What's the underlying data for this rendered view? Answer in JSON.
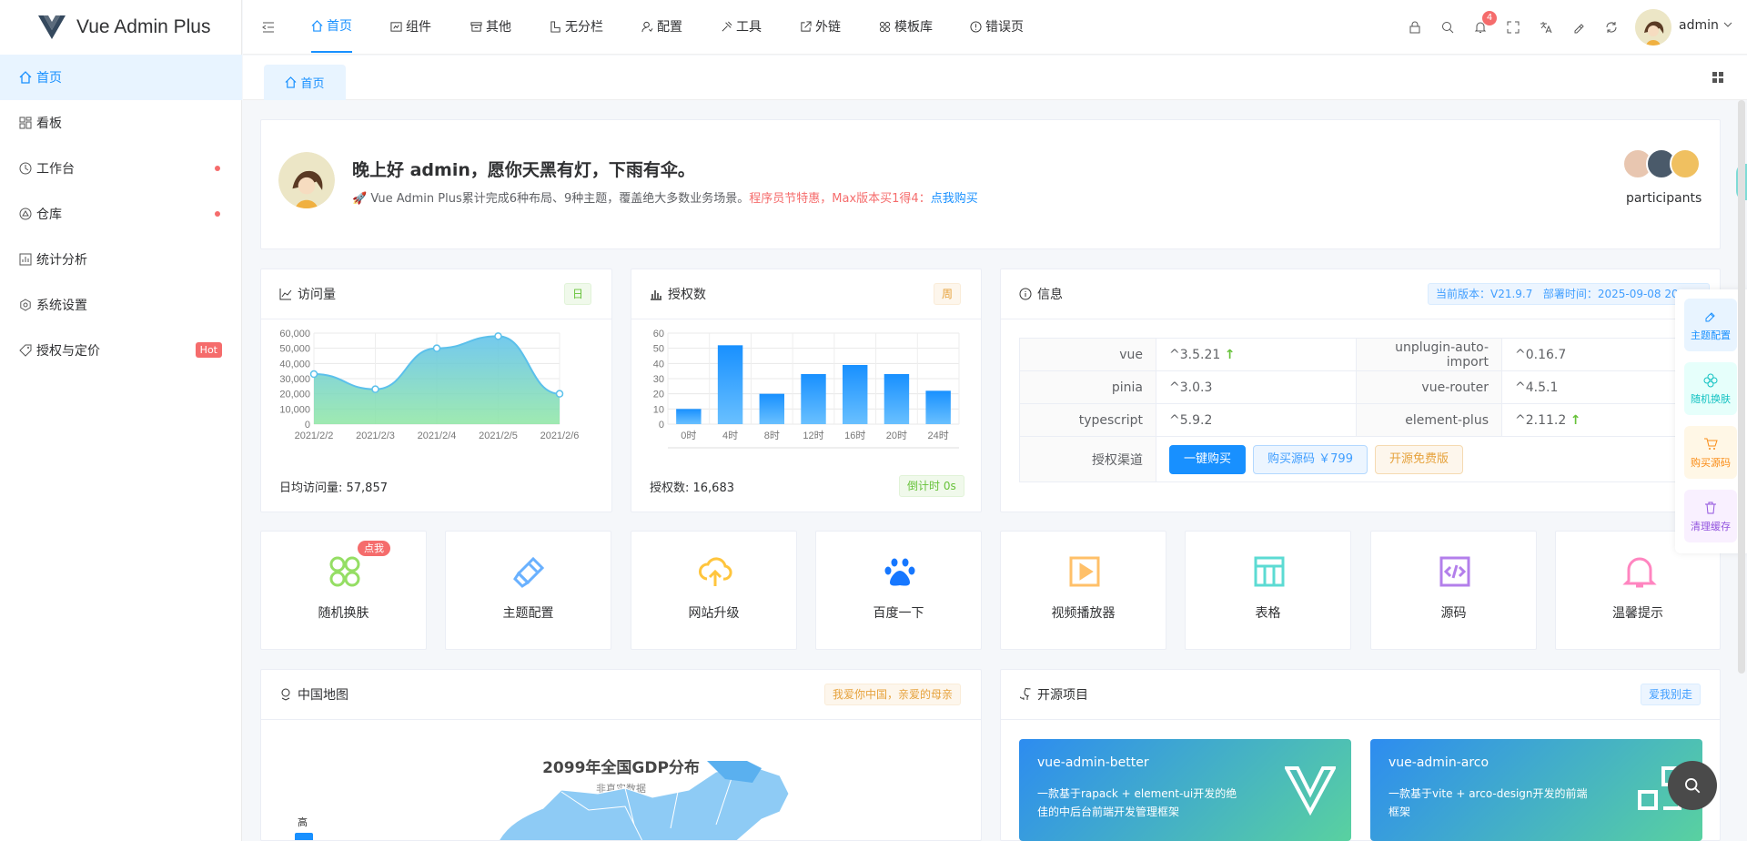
{
  "app": {
    "title": "Vue Admin Plus"
  },
  "sidebar": {
    "items": [
      {
        "label": "首页",
        "icon": "home-icon",
        "active": true
      },
      {
        "label": "看板",
        "icon": "dashboard-icon"
      },
      {
        "label": "工作台",
        "icon": "clock-icon",
        "dot": true
      },
      {
        "label": "仓库",
        "icon": "warehouse-icon",
        "dot": true
      },
      {
        "label": "统计分析",
        "icon": "chart-icon"
      },
      {
        "label": "系统设置",
        "icon": "settings-icon"
      },
      {
        "label": "授权与定价",
        "icon": "tag-icon",
        "badge": "Hot"
      }
    ]
  },
  "header": {
    "nav": [
      {
        "label": "首页",
        "icon": "home-icon",
        "active": true
      },
      {
        "label": "组件",
        "icon": "component-icon"
      },
      {
        "label": "其他",
        "icon": "box-icon"
      },
      {
        "label": "无分栏",
        "icon": "layout-icon"
      },
      {
        "label": "配置",
        "icon": "user-config-icon"
      },
      {
        "label": "工具",
        "icon": "tools-icon"
      },
      {
        "label": "外链",
        "icon": "external-link-icon"
      },
      {
        "label": "模板库",
        "icon": "template-icon"
      },
      {
        "label": "错误页",
        "icon": "error-icon"
      }
    ],
    "notification_count": "4",
    "user": "admin"
  },
  "tabs": {
    "home": "首页"
  },
  "welcome": {
    "greeting": "晚上好 admin，愿你天黑有灯，下雨有伞。",
    "desc": "Vue Admin Plus累计完成6种布局、9种主题，覆盖绝大多数业务场景。",
    "promo": "程序员节特惠，Max版本买1得4：",
    "buy_link": "点我购买",
    "participants": "participants"
  },
  "visits": {
    "title": "访问量",
    "tag": "日",
    "footer": "日均访问量: 57,857",
    "chart_data": {
      "type": "area",
      "categories": [
        "2021/2/2",
        "2021/2/3",
        "2021/2/4",
        "2021/2/5",
        "2021/2/6"
      ],
      "values": [
        33000,
        23000,
        50000,
        58000,
        20000
      ],
      "ylim": [
        0,
        60000
      ],
      "yticks": [
        "0",
        "10,000",
        "20,000",
        "30,000",
        "40,000",
        "50,000",
        "60,000"
      ],
      "grid": true,
      "color_top": "#5bc0eb",
      "color_bottom": "#8ee6a3"
    }
  },
  "auth": {
    "title": "授权数",
    "tag": "周",
    "footer": "授权数: 16,683",
    "countdown": "倒计时 0s",
    "chart_data": {
      "type": "bar",
      "categories": [
        "0时",
        "4时",
        "8时",
        "12时",
        "16时",
        "20时",
        "24时"
      ],
      "values": [
        10,
        52,
        20,
        33,
        39,
        33,
        22
      ],
      "ylim": [
        0,
        60
      ],
      "yticks": [
        "0",
        "10",
        "20",
        "30",
        "40",
        "50",
        "60"
      ],
      "grid": true,
      "color": "#1890ff"
    }
  },
  "info": {
    "title": "信息",
    "version_tag": "当前版本：V21.9.7   部署时间：2025-09-08 20:2",
    "rows": [
      {
        "k1": "vue",
        "v1": "^3.5.21",
        "up1": true,
        "k2": "unplugin-auto-import",
        "v2": "^0.16.7",
        "up2": false
      },
      {
        "k1": "pinia",
        "v1": "^3.0.3",
        "up1": false,
        "k2": "vue-router",
        "v2": "^4.5.1",
        "up2": false
      },
      {
        "k1": "typescript",
        "v1": "^5.9.2",
        "up1": false,
        "k2": "element-plus",
        "v2": "^2.11.2",
        "up2": true
      }
    ],
    "channel_label": "授权渠道",
    "btn_buy": "一键购买",
    "btn_source": "购买源码 ￥799",
    "btn_free": "开源免费版",
    "arrow": "↑"
  },
  "quick": [
    {
      "label": "随机换肤",
      "icon": "clover-icon",
      "color": "#95de64",
      "badge": "点我"
    },
    {
      "label": "主题配置",
      "icon": "brush-icon",
      "color": "#69b1ff"
    },
    {
      "label": "网站升级",
      "icon": "cloud-upload-icon",
      "color": "#ffc53d"
    },
    {
      "label": "百度一下",
      "icon": "paw-icon",
      "color": "#1677ff"
    },
    {
      "label": "视频播放器",
      "icon": "video-icon",
      "color": "#ffc069"
    },
    {
      "label": "表格",
      "icon": "table-icon",
      "color": "#5cdbd3"
    },
    {
      "label": "源码",
      "icon": "code-icon",
      "color": "#b37feb"
    },
    {
      "label": "温馨提示",
      "icon": "bell-icon",
      "color": "#ff85c0"
    }
  ],
  "map": {
    "title": "中国地图",
    "tag": "我爱你中国，亲爱的母亲",
    "chart_title": "2099年全国GDP分布",
    "chart_subtitle": "非真实数据",
    "legend_high": "高"
  },
  "projects": {
    "title": "开源项目",
    "tag": "爱我别走",
    "items": [
      {
        "name": "vue-admin-better",
        "desc": "一款基于rapack + element-ui开发的绝佳的中后台前端开发管理框架"
      },
      {
        "name": "vue-admin-arco",
        "desc": "一款基于vite + arco-design开发的前端框架"
      }
    ]
  },
  "float": [
    {
      "label": "主题配置",
      "color": "#1890ff",
      "bg": "#e8f4ff"
    },
    {
      "label": "随机换肤",
      "color": "#13c2c2",
      "bg": "#e6fffb"
    },
    {
      "label": "购买源码",
      "color": "#fa8c16",
      "bg": "#fff7e6"
    },
    {
      "label": "清理缓存",
      "color": "#9254de",
      "bg": "#f9f0ff"
    }
  ]
}
